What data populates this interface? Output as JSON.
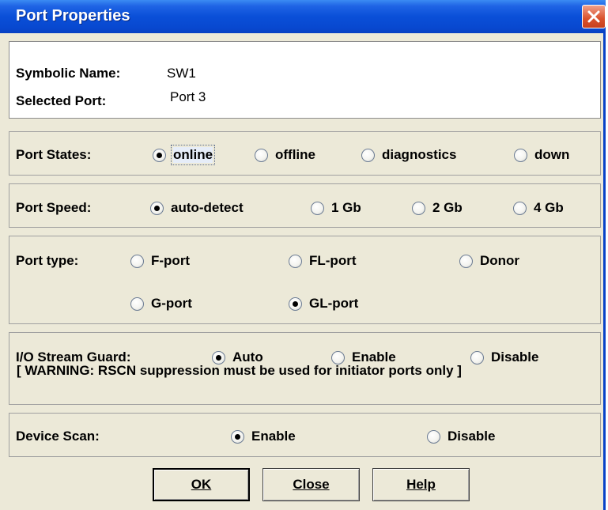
{
  "window": {
    "title": "Port Properties"
  },
  "info": {
    "symbolic_name_label": "Symbolic Name:",
    "symbolic_name_value": "SW1",
    "selected_port_label": "Selected Port:",
    "selected_port_value": "Port 3"
  },
  "port_states": {
    "label": "Port States:",
    "options": [
      {
        "label": "online",
        "selected": true
      },
      {
        "label": "offline",
        "selected": false
      },
      {
        "label": "diagnostics",
        "selected": false
      },
      {
        "label": "down",
        "selected": false
      }
    ]
  },
  "port_speed": {
    "label": "Port Speed:",
    "options": [
      {
        "label": "auto-detect",
        "selected": true
      },
      {
        "label": "1 Gb",
        "selected": false
      },
      {
        "label": "2 Gb",
        "selected": false
      },
      {
        "label": "4 Gb",
        "selected": false
      }
    ]
  },
  "port_type": {
    "label": "Port type:",
    "options": [
      {
        "label": "F-port",
        "selected": false
      },
      {
        "label": "FL-port",
        "selected": false
      },
      {
        "label": "Donor",
        "selected": false
      },
      {
        "label": "G-port",
        "selected": false
      },
      {
        "label": "GL-port",
        "selected": true
      }
    ]
  },
  "io_stream_guard": {
    "label": "I/O Stream Guard:",
    "options": [
      {
        "label": "Auto",
        "selected": true
      },
      {
        "label": "Enable",
        "selected": false
      },
      {
        "label": "Disable",
        "selected": false
      }
    ],
    "warning": "[ WARNING: RSCN suppression must be used for initiator ports only ]"
  },
  "device_scan": {
    "label": "Device Scan:",
    "options": [
      {
        "label": "Enable",
        "selected": true
      },
      {
        "label": "Disable",
        "selected": false
      }
    ]
  },
  "buttons": {
    "ok": "OK",
    "close": "Close",
    "help": "Help"
  },
  "colors": {
    "title_bar": "#0a4fd8",
    "close_button": "#d9512c",
    "dialog_bg": "#ece9d8"
  }
}
